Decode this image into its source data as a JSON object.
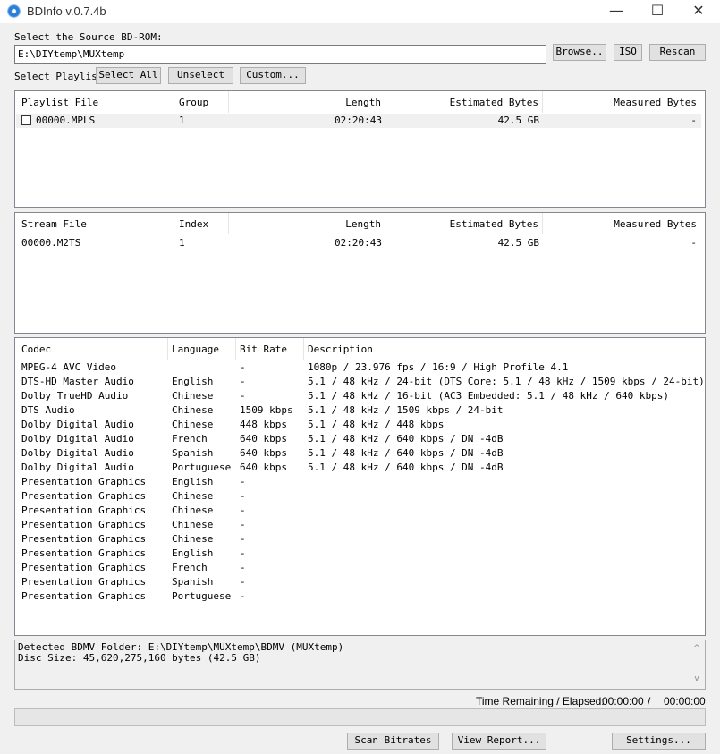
{
  "window": {
    "title": "BDInfo v.0.7.4b",
    "minimize_glyph": "—",
    "maximize_glyph": "☐",
    "close_glyph": "✕"
  },
  "source": {
    "label": "Select the Source BD-ROM:",
    "path": "E:\\DIYtemp\\MUXtemp",
    "browse": "Browse..",
    "iso": "ISO",
    "rescan": "Rescan"
  },
  "playlist_bar": {
    "label": "Select Playlist",
    "select_all": "Select All",
    "unselect": "Unselect",
    "custom": "Custom..."
  },
  "playlist_table": {
    "headers": [
      "Playlist File",
      "Group",
      "Length",
      "Estimated Bytes",
      "Measured Bytes"
    ],
    "rows": [
      {
        "file": "00000.MPLS",
        "group": "1",
        "length": "02:20:43",
        "estimated": "42.5 GB",
        "measured": "-"
      }
    ]
  },
  "stream_table": {
    "headers": [
      "Stream File",
      "Index",
      "Length",
      "Estimated Bytes",
      "Measured Bytes"
    ],
    "rows": [
      {
        "file": "00000.M2TS",
        "index": "1",
        "length": "02:20:43",
        "estimated": "42.5 GB",
        "measured": "-"
      }
    ]
  },
  "codec_table": {
    "headers": [
      "Codec",
      "Language",
      "Bit Rate",
      "Description"
    ],
    "rows": [
      {
        "codec": "MPEG-4 AVC Video",
        "language": "",
        "bitrate": "-",
        "description": "1080p / 23.976 fps / 16:9 / High Profile 4.1"
      },
      {
        "codec": "DTS-HD Master Audio",
        "language": "English",
        "bitrate": "-",
        "description": "5.1 / 48 kHz / 24-bit (DTS Core: 5.1 / 48 kHz / 1509 kbps / 24-bit)"
      },
      {
        "codec": "Dolby TrueHD Audio",
        "language": "Chinese",
        "bitrate": "-",
        "description": "5.1 / 48 kHz / 16-bit (AC3 Embedded: 5.1 / 48 kHz / 640 kbps)"
      },
      {
        "codec": "DTS Audio",
        "language": "Chinese",
        "bitrate": "1509 kbps",
        "description": "5.1 / 48 kHz / 1509 kbps / 24-bit"
      },
      {
        "codec": "Dolby Digital Audio",
        "language": "Chinese",
        "bitrate": "448 kbps",
        "description": "5.1 / 48 kHz / 448 kbps"
      },
      {
        "codec": "Dolby Digital Audio",
        "language": "French",
        "bitrate": "640 kbps",
        "description": "5.1 / 48 kHz / 640 kbps / DN -4dB"
      },
      {
        "codec": "Dolby Digital Audio",
        "language": "Spanish",
        "bitrate": "640 kbps",
        "description": "5.1 / 48 kHz / 640 kbps / DN -4dB"
      },
      {
        "codec": "Dolby Digital Audio",
        "language": "Portuguese",
        "bitrate": "640 kbps",
        "description": "5.1 / 48 kHz / 640 kbps / DN -4dB"
      },
      {
        "codec": "Presentation Graphics",
        "language": "English",
        "bitrate": "-",
        "description": ""
      },
      {
        "codec": "Presentation Graphics",
        "language": "Chinese",
        "bitrate": "-",
        "description": ""
      },
      {
        "codec": "Presentation Graphics",
        "language": "Chinese",
        "bitrate": "-",
        "description": ""
      },
      {
        "codec": "Presentation Graphics",
        "language": "Chinese",
        "bitrate": "-",
        "description": ""
      },
      {
        "codec": "Presentation Graphics",
        "language": "Chinese",
        "bitrate": "-",
        "description": ""
      },
      {
        "codec": "Presentation Graphics",
        "language": "English",
        "bitrate": "-",
        "description": ""
      },
      {
        "codec": "Presentation Graphics",
        "language": "French",
        "bitrate": "-",
        "description": ""
      },
      {
        "codec": "Presentation Graphics",
        "language": "Spanish",
        "bitrate": "-",
        "description": ""
      },
      {
        "codec": "Presentation Graphics",
        "language": "Portuguese",
        "bitrate": "-",
        "description": ""
      }
    ]
  },
  "report_log": {
    "line1": "Detected BDMV Folder: E:\\DIYtemp\\MUXtemp\\BDMV (MUXtemp)",
    "line2": "Disc Size: 45,620,275,160 bytes (42.5 GB)"
  },
  "status": {
    "label": "Time Remaining / Elapsed:",
    "remaining": "00:00:00",
    "separator": "/",
    "elapsed": "00:00:00",
    "progress": 0
  },
  "footer": {
    "scan_bitrates": "Scan Bitrates",
    "view_report": "View Report...",
    "settings": "Settings..."
  }
}
